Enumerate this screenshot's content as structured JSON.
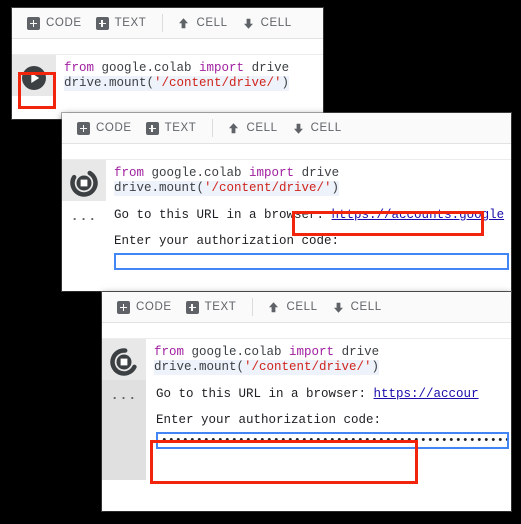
{
  "background_color": "#000000",
  "toolbar": {
    "add_code_label": "CODE",
    "add_text_label": "TEXT",
    "move_cell_up_label": "CELL",
    "move_cell_down_label": "CELL",
    "add_code_icon": "plus-square-icon",
    "add_text_icon": "plus-square-icon",
    "move_up_icon": "arrow-up-icon",
    "move_down_icon": "arrow-down-icon"
  },
  "code_cell": {
    "line1_kw1": "from",
    "line1_mid": " google.colab ",
    "line1_kw2": "import",
    "line1_tail": " drive",
    "line2_head": "drive.mount(",
    "line2_str": "'/content/drive/'",
    "line2_tail": ")"
  },
  "panels": [
    {
      "id": "panel-run",
      "run_icon": "play-circle-icon",
      "run_state": "idle",
      "highlight": "run-button"
    },
    {
      "id": "panel-auth-url",
      "run_icon": "stop-circle-busy-icon",
      "run_state": "running",
      "output_marker": "...",
      "output_text": "Go to this URL in a browser: ",
      "output_url": "https://accounts.google",
      "prompt_label": "Enter your authorization code:",
      "input_value": "",
      "highlight": "url-link"
    },
    {
      "id": "panel-auth-code",
      "run_icon": "stop-circle-busy-icon",
      "run_state": "running",
      "output_marker": "...",
      "output_text": "Go to this URL in a browser: ",
      "output_url": "https://accour",
      "prompt_label": "Enter your authorization code:",
      "input_value": "••••••••••••••••••••••••••••••••••••••••••••••••••••••••••••",
      "highlight": "authorization-code-field"
    }
  ],
  "colors": {
    "keyword": "#a020a0",
    "string": "#d0241c",
    "link": "#1a0dab",
    "highlight": "#f2250c",
    "input_border": "#4285f4"
  }
}
